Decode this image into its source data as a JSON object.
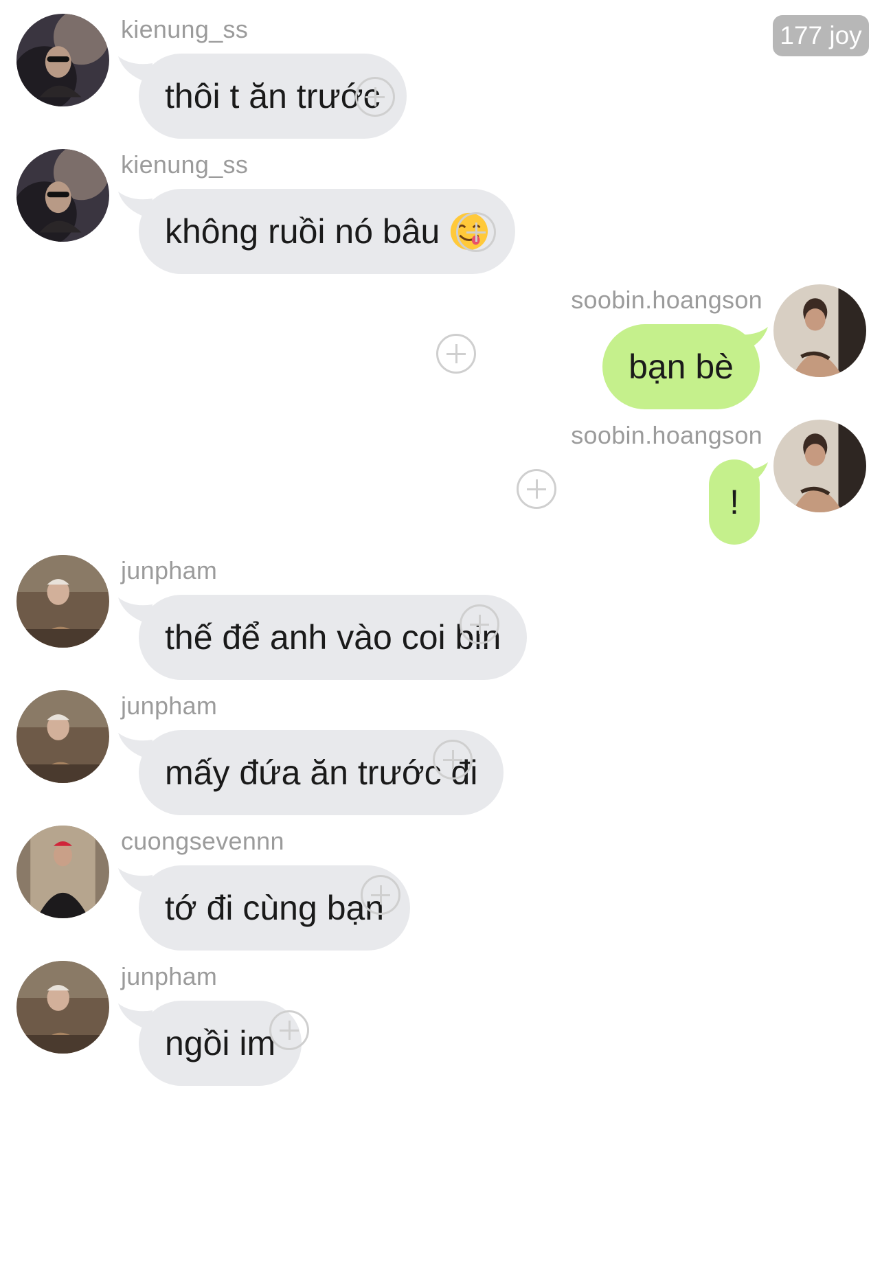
{
  "badge": {
    "text": "177 joy"
  },
  "messages": [
    {
      "user": "kienung_ss",
      "text": "thôi t ăn trước",
      "side": "left",
      "emoji": ""
    },
    {
      "user": "kienung_ss",
      "text": "không ruồi nó bâu",
      "side": "left",
      "emoji": "face-savoring-food-icon"
    },
    {
      "user": "soobin.hoangson",
      "text": "bạn bè",
      "side": "right",
      "emoji": ""
    },
    {
      "user": "soobin.hoangson",
      "text": "!",
      "side": "right",
      "emoji": ""
    },
    {
      "user": "junpham",
      "text": "thế để anh vào coi bin",
      "side": "left",
      "emoji": ""
    },
    {
      "user": "junpham",
      "text": "mấy đứa ăn trước đi",
      "side": "left",
      "emoji": ""
    },
    {
      "user": "cuongsevennn",
      "text": "tớ đi cùng bạn",
      "side": "left",
      "emoji": ""
    },
    {
      "user": "junpham",
      "text": "ngồi im",
      "side": "left",
      "emoji": ""
    }
  ],
  "colors": {
    "incoming_bubble": "#e8e9ec",
    "outgoing_bubble": "#c5f08c",
    "username": "#9b9b9b",
    "badge": "#b7b7b7"
  }
}
